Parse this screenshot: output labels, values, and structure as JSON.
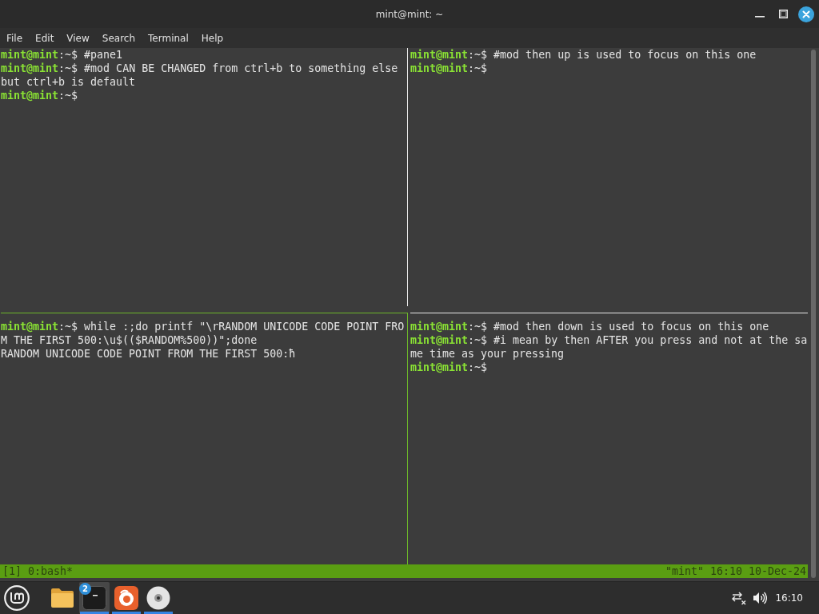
{
  "window": {
    "title": "mint@mint: ~"
  },
  "menu": [
    "File",
    "Edit",
    "View",
    "Search",
    "Terminal",
    "Help"
  ],
  "panes": [
    {
      "active": false,
      "lines": [
        {
          "user": "mint@mint",
          "cwd": ":~$",
          "text": "#pane1"
        },
        {
          "user": "mint@mint",
          "cwd": ":~$",
          "text": "#mod CAN BE CHANGED from ctrl+b to something else"
        },
        {
          "text": "but ctrl+b is default"
        },
        {
          "user": "mint@mint",
          "cwd": ":~$"
        }
      ]
    },
    {
      "active": false,
      "lines": [
        {
          "user": "mint@mint",
          "cwd": ":~$",
          "text": "#mod then up is used to focus on this one"
        },
        {
          "user": "mint@mint",
          "cwd": ":~$"
        }
      ]
    },
    {
      "active": true,
      "lines": [
        {
          "user": "mint@mint",
          "cwd": ":~$",
          "text": "while :;do printf \"\\rRANDOM UNICODE CODE POINT FRO"
        },
        {
          "text": "M THE FIRST 500:\\u$(($RANDOM%500))\";done"
        },
        {
          "text": "RANDOM UNICODE CODE POINT FROM THE FIRST 500:ħ"
        }
      ]
    },
    {
      "active": false,
      "lines": [
        {
          "user": "mint@mint",
          "cwd": ":~$",
          "text": "#mod then down is used to focus on this one"
        },
        {
          "user": "mint@mint",
          "cwd": ":~$",
          "text": "#i mean by then AFTER you press and not at the sa"
        },
        {
          "text": "me time as your pressing"
        },
        {
          "user": "mint@mint",
          "cwd": ":~$"
        }
      ]
    }
  ],
  "status_bar": {
    "left": "[1] 0:bash*",
    "right": "\"mint\" 16:10 10-Dec-24"
  },
  "taskbar": {
    "apps": [
      {
        "kind": "folder",
        "active": false,
        "running": false
      },
      {
        "kind": "terminal",
        "active": true,
        "running": true,
        "badge": "2"
      },
      {
        "kind": "browser",
        "active": false,
        "running": true
      },
      {
        "kind": "disc",
        "active": false,
        "running": true
      }
    ],
    "clock": "16:10"
  }
}
